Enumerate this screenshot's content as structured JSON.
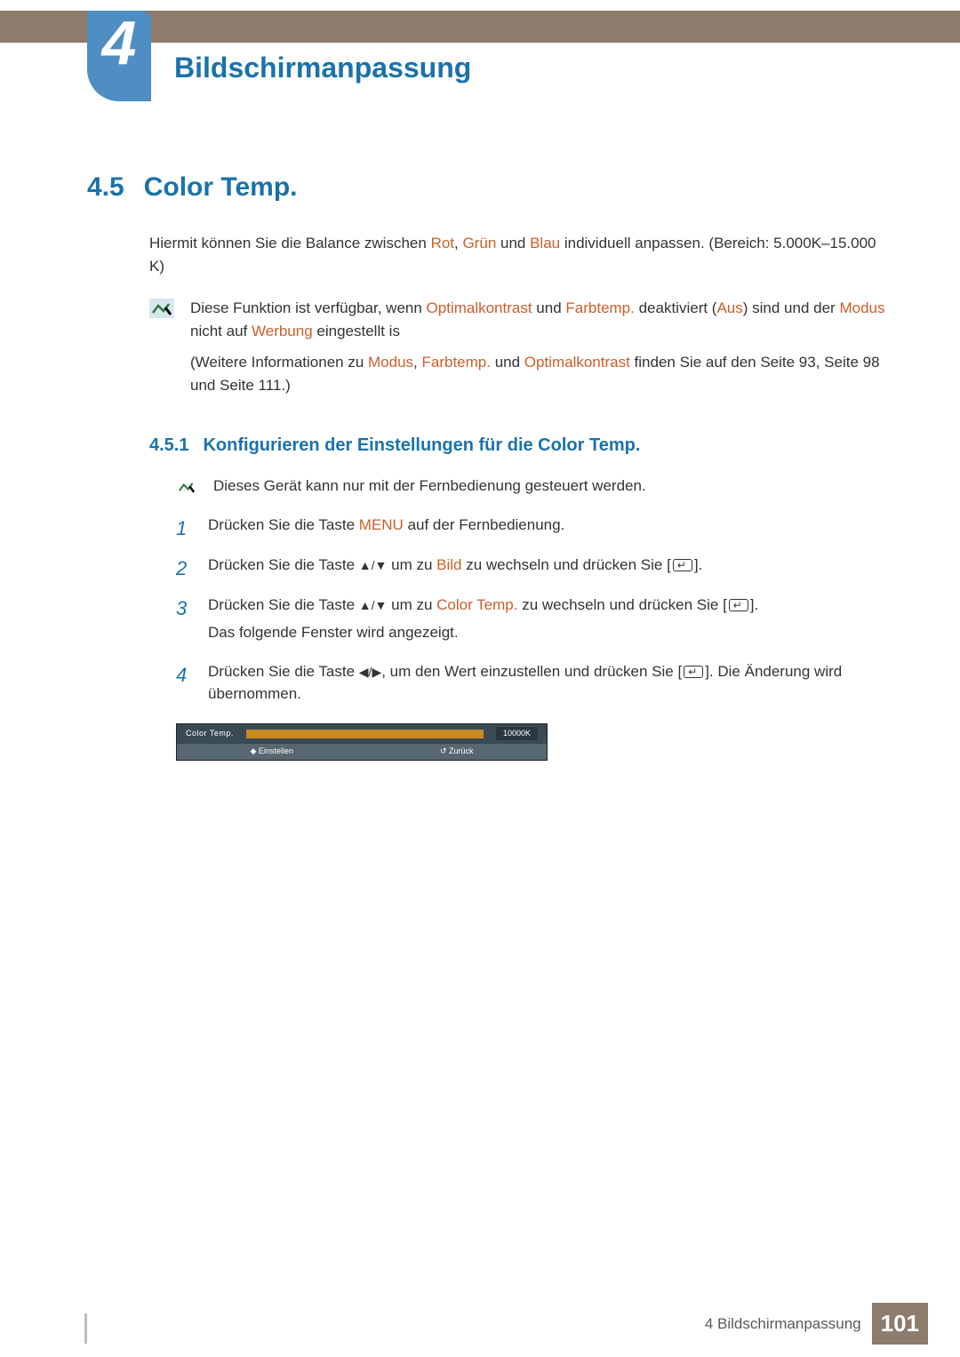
{
  "chapter": {
    "number": "4",
    "title": "Bildschirmanpassung"
  },
  "section": {
    "number": "4.5",
    "title": "Color Temp.",
    "intro_pre": "Hiermit können Sie die Balance zwischen ",
    "intro_rot": "Rot",
    "intro_sep1": ", ",
    "intro_gruen": "Grün",
    "intro_sep2": " und ",
    "intro_blau": "Blau",
    "intro_post": " individuell anpassen. (Bereich: 5.000K–15.000 K)"
  },
  "note1": {
    "p1_pre": "Diese Funktion ist verfügbar, wenn ",
    "p1_t1": "Optimalkontrast",
    "p1_mid1": " und ",
    "p1_t2": "Farbtemp.",
    "p1_mid2": " deaktiviert (",
    "p1_t3": "Aus",
    "p1_mid3": ") sind und der ",
    "p1_t4": "Modus",
    "p1_mid4": " nicht auf ",
    "p1_t5": "Werbung",
    "p1_post": " eingestellt is",
    "p2_pre": "(Weitere Informationen zu ",
    "p2_t1": "Modus",
    "p2_sep1": ", ",
    "p2_t2": "Farbtemp.",
    "p2_sep2": " und ",
    "p2_t3": "Optimalkontrast",
    "p2_post": " finden Sie auf den Seite 93, Seite 98 und Seite 111.)"
  },
  "subsection": {
    "number": "4.5.1",
    "title": "Konfigurieren der Einstellungen für die Color Temp."
  },
  "note2": "Dieses Gerät kann nur mit der Fernbedienung gesteuert werden.",
  "steps": {
    "s1": {
      "num": "1",
      "pre": "Drücken Sie die Taste ",
      "menu": "MENU",
      "post": " auf der Fernbedienung."
    },
    "s2": {
      "num": "2",
      "pre": "Drücken Sie die Taste ",
      "arrows": "▲/▼",
      "mid": " um zu ",
      "term": "Bild",
      "post1": " zu wechseln und drücken Sie [",
      "post2": "]."
    },
    "s3": {
      "num": "3",
      "pre": "Drücken Sie die Taste ",
      "arrows": "▲/▼",
      "mid": " um zu ",
      "term": "Color Temp.",
      "post1": " zu wechseln und drücken Sie [",
      "post2": "].",
      "line2": "Das folgende Fenster wird angezeigt."
    },
    "s4": {
      "num": "4",
      "pre": "Drücken Sie die Taste ",
      "arrows": "◀/▶",
      "mid": ", um den Wert einzustellen und drücken Sie [",
      "post": "]. Die Änderung wird übernommen."
    }
  },
  "osd": {
    "label": "Color Temp.",
    "value": "10000K",
    "hint_left": "◆ Einstellen",
    "hint_right": "↺ Zurück"
  },
  "footer": {
    "text": "4 Bildschirmanpassung",
    "page": "101"
  }
}
